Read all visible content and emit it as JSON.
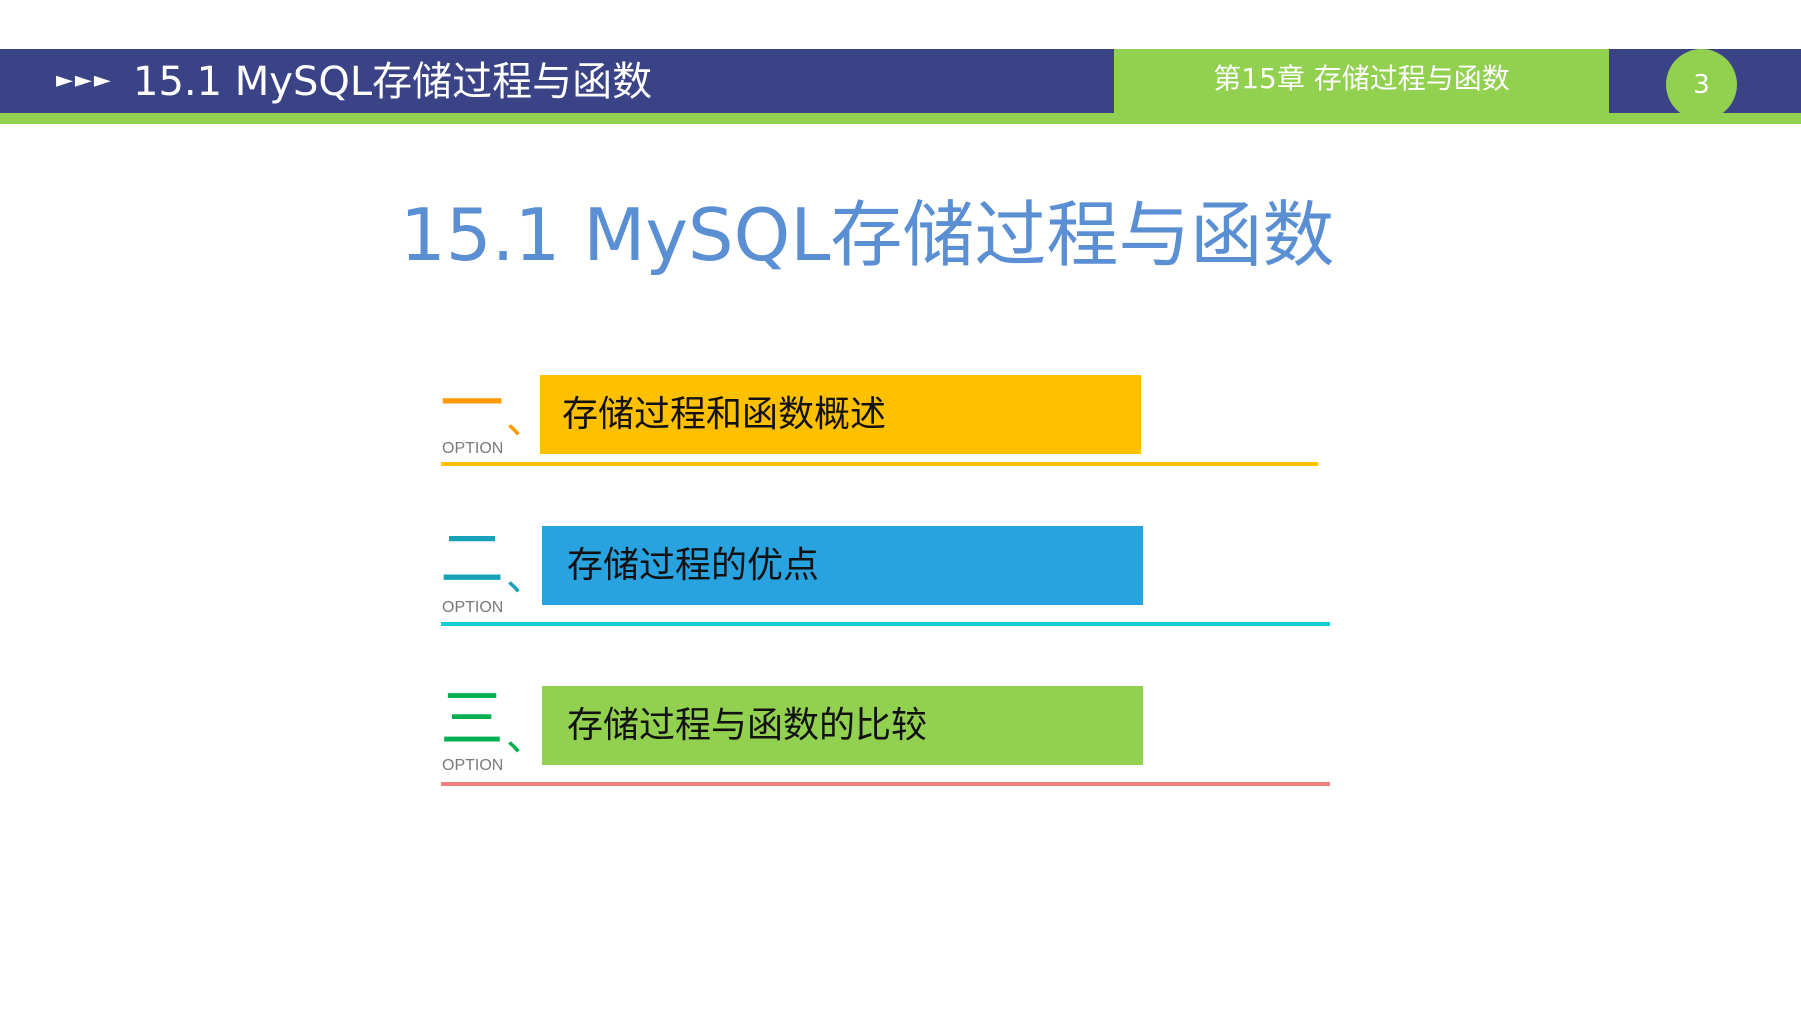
{
  "header": {
    "arrows": "►►►",
    "title": "15.1 MySQL存储过程与函数",
    "chapter": "第15章 存储过程与函数",
    "page_number": "3"
  },
  "slide": {
    "title": "15.1 MySQL存储过程与函数"
  },
  "options": [
    {
      "numeral": "一",
      "mark": "、",
      "caption": "OPTION",
      "label": "存储过程和函数概述",
      "numeral_color": "#ff9900",
      "box_color": "#ffc000",
      "line_color": "#ffc000"
    },
    {
      "numeral": "二",
      "mark": "、",
      "caption": "OPTION",
      "label": "存储过程的优点",
      "numeral_color": "#17a2b8",
      "box_color": "#29a3e0",
      "line_color": "#17cbd1"
    },
    {
      "numeral": "三",
      "mark": "、",
      "caption": "OPTION",
      "label": "存储过程与函数的比较",
      "numeral_color": "#00b050",
      "box_color": "#92d050",
      "line_color": "#f08080"
    }
  ],
  "colors": {
    "header_bar": "#3b4387",
    "accent_green": "#92d050",
    "title_blue": "#5b8fd4"
  }
}
